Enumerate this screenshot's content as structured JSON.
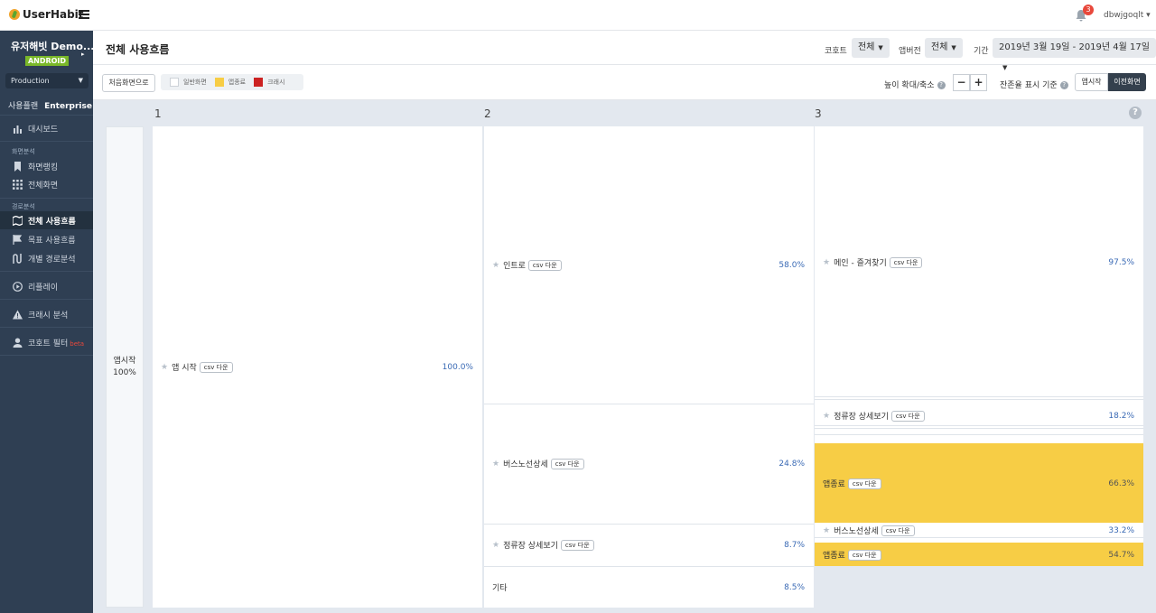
{
  "brand": {
    "name": "UserHabit"
  },
  "notifications": {
    "count": "3"
  },
  "user": {
    "name": "dbwjgoqlt"
  },
  "sidebar": {
    "project": "유저해빗 Demo...",
    "platform": "ANDROID",
    "environment": "Production",
    "plan_label": "사용플랜",
    "plan_value": "Enterprise",
    "dashboard": "대시보드",
    "section_screen": "화면분석",
    "screen_ranking": "화면랭킹",
    "all_screens": "전체화면",
    "section_path": "경로분석",
    "all_flow": "전체 사용흐름",
    "goal_flow": "목표 사용흐름",
    "individual_path": "개별 경로분석",
    "replay": "리플레이",
    "crash": "크래시 분석",
    "cohort_filter": "코호트 필터",
    "beta": "beta"
  },
  "header": {
    "title": "전체 사용흐름",
    "cohort_label": "코호트",
    "cohort_value": "전체",
    "version_label": "앱버전",
    "version_value": "전체",
    "period_label": "기간",
    "period_value": "2019년 3월 19일 - 2019년 4월 17일"
  },
  "toolbar": {
    "first_screen_btn": "처음화면으로",
    "legend_normal": "일반화면",
    "legend_exit": "앱종료",
    "legend_crash": "크래시",
    "zoom_label": "높이 확대/축소",
    "zoom_minus": "−",
    "zoom_plus": "+",
    "retention_label": "잔존율 표시 기준",
    "toggle_app_start": "앱시작",
    "toggle_prev_screen": "이전화면"
  },
  "colors": {
    "exit": "#f7cd45",
    "crash": "#cc2222",
    "accent": "#3a6ab5"
  },
  "flow": {
    "steps": [
      "1",
      "2",
      "3"
    ],
    "help": "?",
    "start": {
      "label": "앱시작",
      "pct": "100%"
    },
    "csv": "csv 다운",
    "col1": [
      {
        "name": "앱 시작",
        "pct": "100.0%"
      }
    ],
    "col2": [
      {
        "name": "인트로",
        "pct": "58.0%"
      },
      {
        "name": "버스노선상세",
        "pct": "24.8%"
      },
      {
        "name": "정류장 상세보기",
        "pct": "8.7%"
      },
      {
        "name": "기타",
        "pct": "8.5%"
      }
    ],
    "col3": [
      {
        "name": "메인 - 즐겨찾기",
        "pct": "97.5%"
      },
      {
        "name": "정류장 상세보기",
        "pct": "18.2%"
      },
      {
        "name": "앱종료",
        "pct": "66.3%"
      },
      {
        "name": "버스노선상세",
        "pct": "33.2%"
      },
      {
        "name": "앱종료",
        "pct": "54.7%"
      }
    ]
  }
}
